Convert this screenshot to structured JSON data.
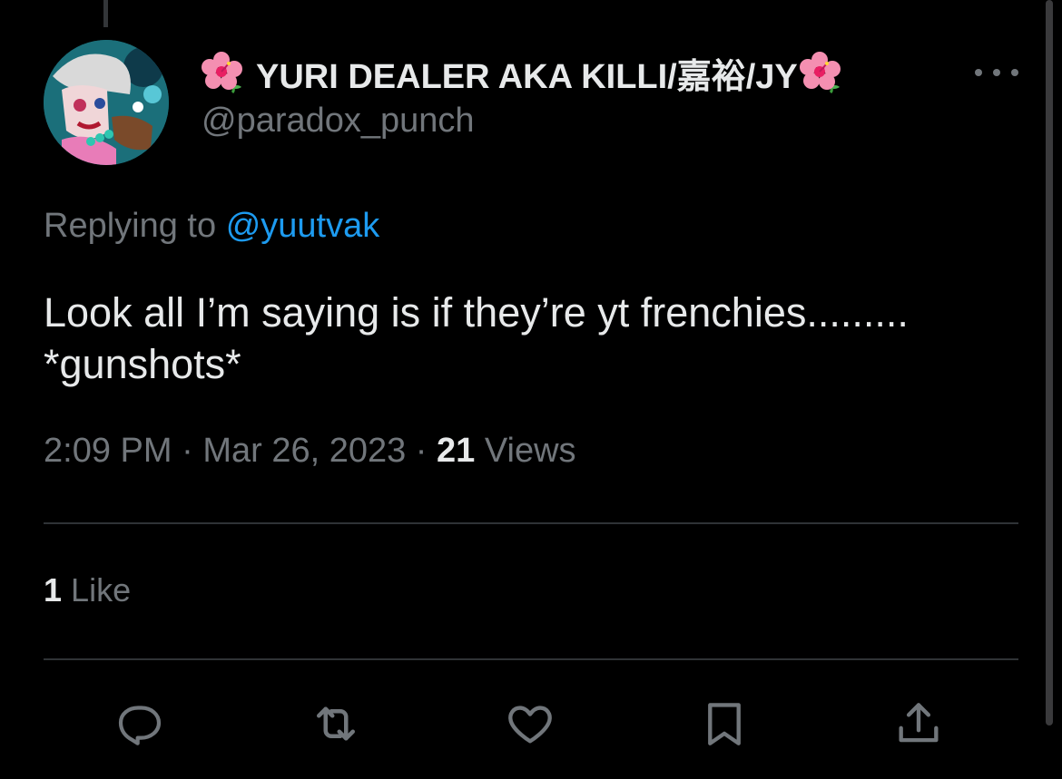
{
  "tweet": {
    "display_name": "YURI DEALER AKA KILLI/嘉裕/JY",
    "name_emoji_left": "hibiscus-icon",
    "name_emoji_right": "hibiscus-icon",
    "handle": "@paradox_punch",
    "replying_prefix": "Replying to",
    "replying_to": "@yuutvak",
    "text": "Look all I’m saying is if they’re yt frenchies.........\n*gunshots*",
    "time": "2:09 PM",
    "date": "Mar 26, 2023",
    "separator": "·",
    "views_count": "21",
    "views_label": "Views",
    "likes_count": "1",
    "likes_label": "Like"
  },
  "actions": {
    "reply_icon": "reply-icon",
    "retweet_icon": "retweet-icon",
    "like_icon": "heart-icon",
    "bookmark_icon": "bookmark-icon",
    "share_icon": "share-icon"
  },
  "colors": {
    "background": "#000000",
    "primary_text": "#e7e9ea",
    "secondary_text": "#71767b",
    "link": "#1d9bf0",
    "divider": "#2f3336"
  }
}
